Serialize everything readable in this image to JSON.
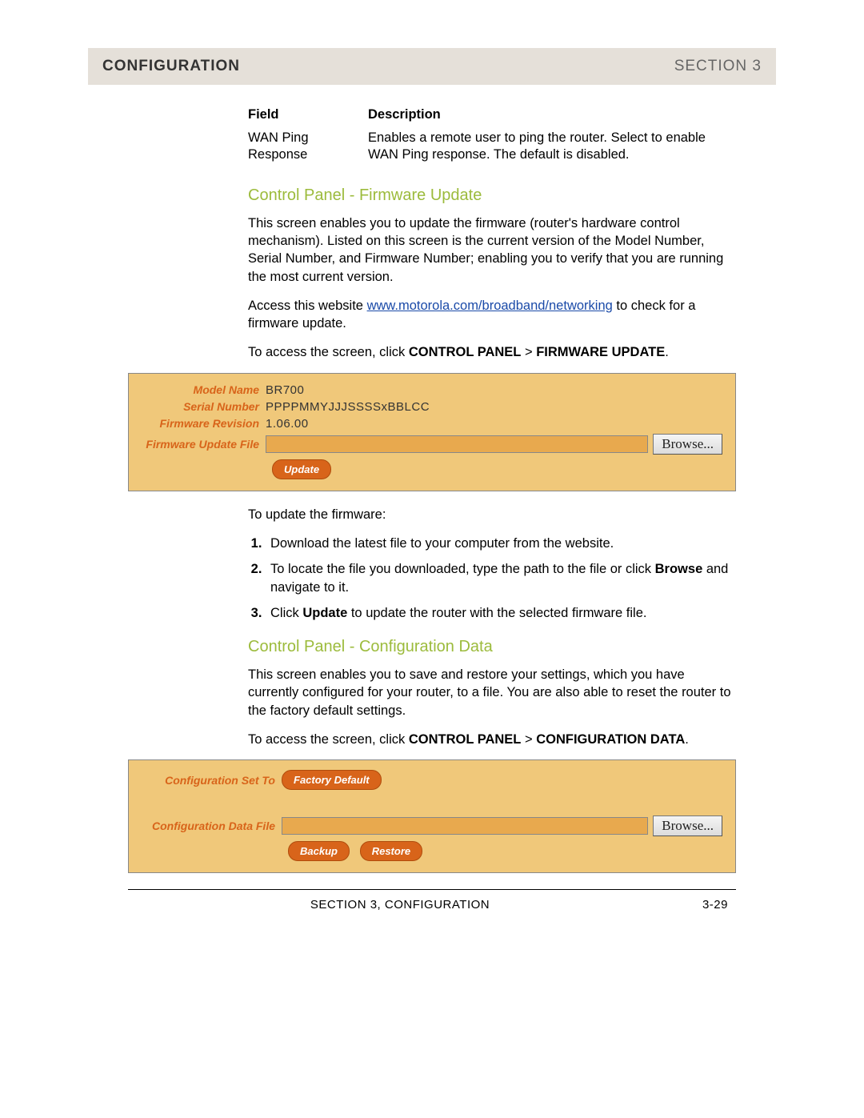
{
  "header": {
    "left": "CONFIGURATION",
    "right": "SECTION 3"
  },
  "fieldTable": {
    "headField": "Field",
    "headDesc": "Description",
    "row1Field": "WAN Ping Response",
    "row1Desc": "Enables a remote user to ping the router. Select to enable WAN Ping response. The default is disabled."
  },
  "firmware": {
    "heading": "Control Panel - Firmware Update",
    "p1": "This screen enables you to update the firmware (router's hardware control mechanism). Listed on this screen is the current version of the Model Number, Serial Number, and Firmware Number; enabling you to verify that you are running the most current version.",
    "p2a": "Access this website ",
    "link": "www.motorola.com/broadband/networking",
    "p2b": " to check for a firmware update.",
    "p3a": "To access the screen, click ",
    "p3b": "CONTROL PANEL",
    "p3c": " > ",
    "p3d": "FIRMWARE UPDATE",
    "p3e": ".",
    "panel": {
      "modelLabel": "Model Name",
      "modelValue": "BR700",
      "serialLabel": "Serial Number",
      "serialValue": "PPPPMMYJJJSSSSxBBLCC",
      "revLabel": "Firmware Revision",
      "revValue": "1.06.00",
      "fileLabel": "Firmware Update File",
      "browse": "Browse...",
      "update": "Update"
    },
    "stepsIntro": "To update the firmware:",
    "step1": "Download the latest file to your computer from the website.",
    "step2a": "To locate the file you downloaded, type the path to the file or click ",
    "step2b": "Browse",
    "step2c": " and navigate to it.",
    "step3a": "Click ",
    "step3b": "Update",
    "step3c": " to update the router with the selected firmware file."
  },
  "configData": {
    "heading": "Control Panel - Configuration Data",
    "p1": "This screen enables you to save and restore your settings, which you have currently configured for your router, to a file. You are also able to reset the router to the factory default settings.",
    "p2a": "To access the screen, click ",
    "p2b": "CONTROL PANEL",
    "p2c": " > ",
    "p2d": "CONFIGURATION DATA",
    "p2e": ".",
    "panel": {
      "setToLabel": "Configuration Set To",
      "factoryBtn": "Factory Default",
      "fileLabel": "Configuration Data File",
      "browse": "Browse...",
      "backup": "Backup",
      "restore": "Restore"
    }
  },
  "footer": {
    "center": "SECTION 3, CONFIGURATION",
    "right": "3-29"
  }
}
